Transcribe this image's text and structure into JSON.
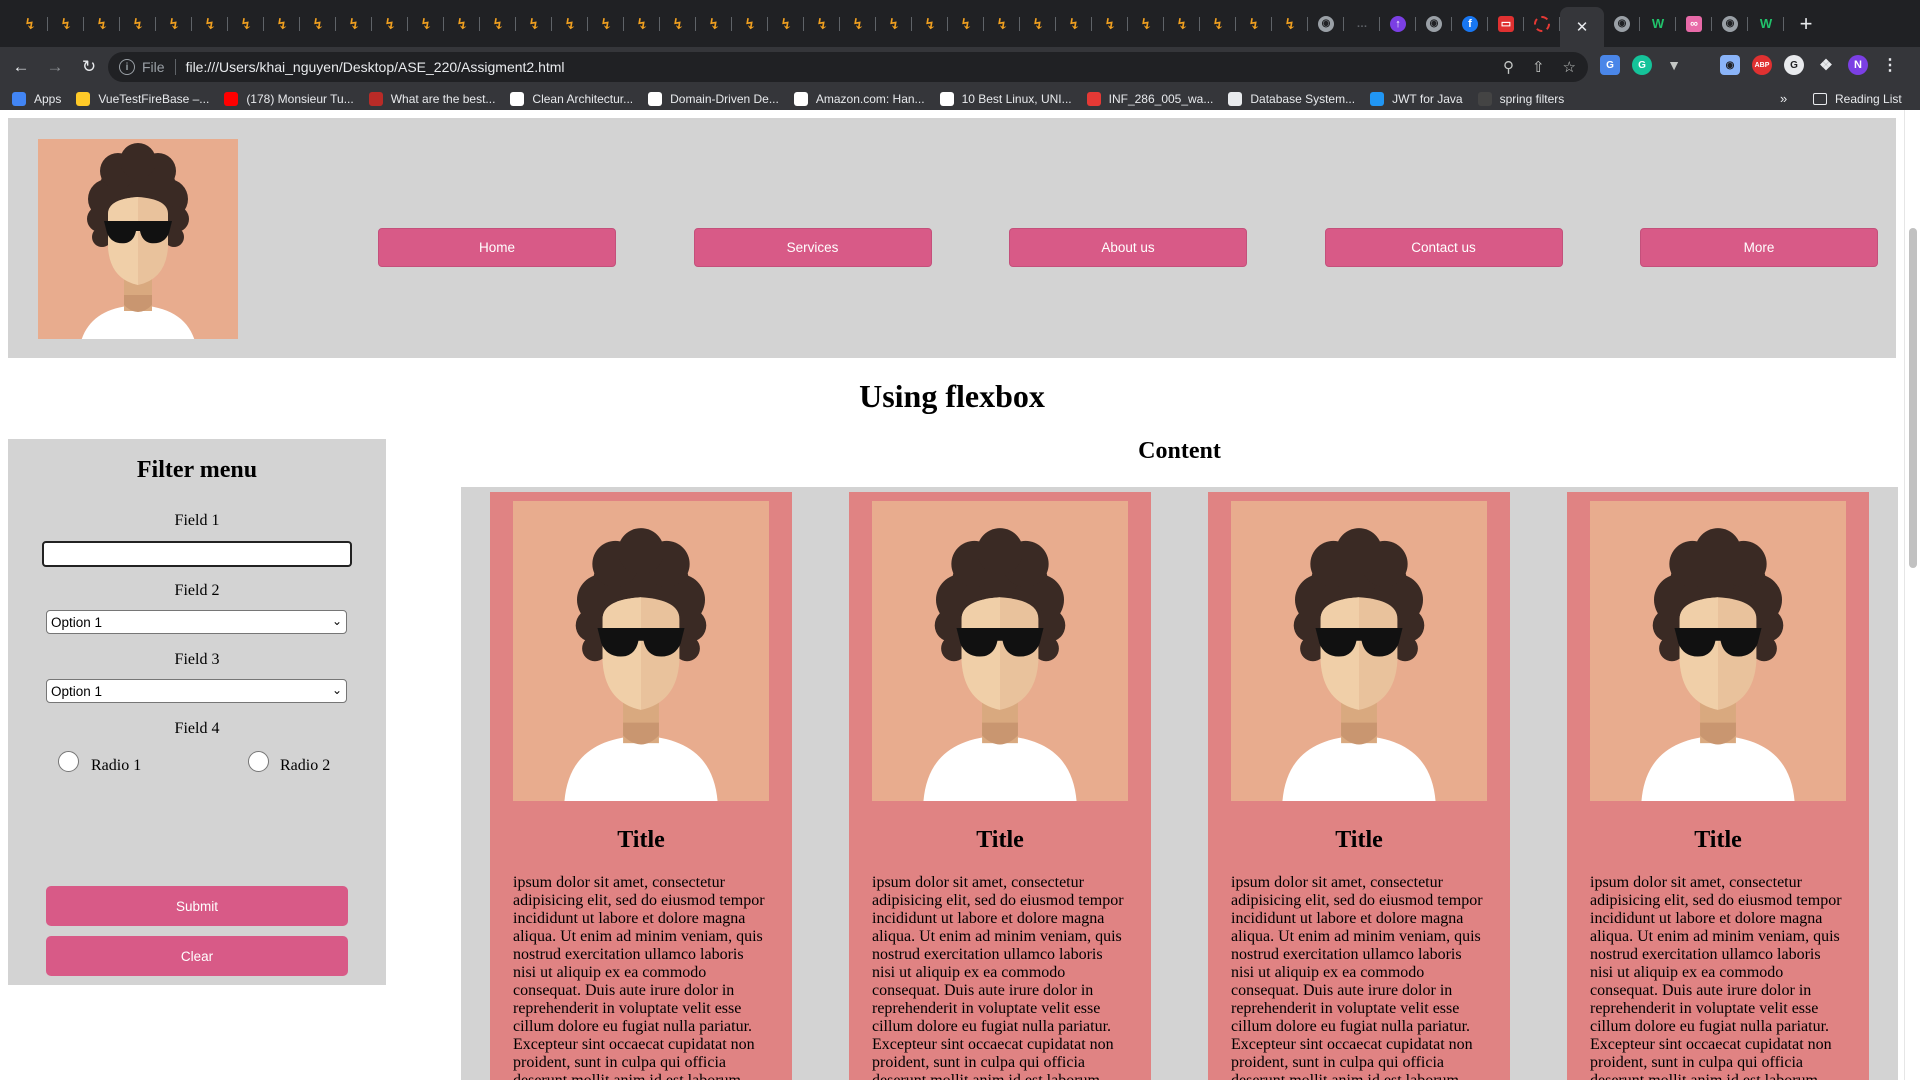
{
  "browser": {
    "tabs": [
      {
        "icon": "tweet-tab-icon"
      },
      {
        "icon": "tweet-tab-icon"
      },
      {
        "icon": "tweet-tab-icon"
      },
      {
        "icon": "tweet-tab-icon"
      },
      {
        "icon": "tweet-tab-icon"
      },
      {
        "icon": "tweet-tab-icon"
      },
      {
        "icon": "tweet-tab-icon"
      },
      {
        "icon": "tweet-tab-icon"
      },
      {
        "icon": "tweet-tab-icon"
      },
      {
        "icon": "tweet-tab-icon"
      },
      {
        "icon": "tweet-tab-icon"
      },
      {
        "icon": "tweet-tab-icon"
      },
      {
        "icon": "tweet-tab-icon"
      },
      {
        "icon": "tweet-tab-icon"
      },
      {
        "icon": "tweet-tab-icon"
      },
      {
        "icon": "tweet-tab-icon"
      },
      {
        "icon": "tweet-tab-icon"
      },
      {
        "icon": "tweet-tab-icon"
      },
      {
        "icon": "tweet-tab-icon"
      },
      {
        "icon": "tweet-tab-icon"
      },
      {
        "icon": "tweet-tab-icon"
      },
      {
        "icon": "tweet-tab-icon"
      },
      {
        "icon": "tweet-tab-icon"
      },
      {
        "icon": "tweet-tab-icon"
      },
      {
        "icon": "tweet-tab-icon"
      },
      {
        "icon": "tweet-tab-icon"
      },
      {
        "icon": "tweet-tab-icon"
      },
      {
        "icon": "tweet-tab-icon"
      },
      {
        "icon": "tweet-tab-icon"
      },
      {
        "icon": "tweet-tab-icon"
      },
      {
        "icon": "tweet-tab-icon"
      },
      {
        "icon": "tweet-tab-icon"
      },
      {
        "icon": "tweet-tab-icon"
      },
      {
        "icon": "tweet-tab-icon"
      },
      {
        "icon": "tweet-tab-icon"
      },
      {
        "icon": "tweet-tab-icon"
      },
      {
        "icon": "globe-icon"
      },
      {
        "icon": "blank-page-icon"
      },
      {
        "icon": "purple-extension-icon"
      },
      {
        "icon": "globe-icon"
      },
      {
        "icon": "facebook-icon"
      },
      {
        "icon": "red-app-icon"
      },
      {
        "icon": "loading-spinner-icon"
      },
      {
        "icon": "close-icon",
        "active": true
      },
      {
        "icon": "globe-icon"
      },
      {
        "icon": "w-icon"
      },
      {
        "icon": "pink-app-icon"
      },
      {
        "icon": "globe-icon"
      },
      {
        "icon": "w-icon"
      }
    ],
    "omnibox": {
      "scheme_label": "File",
      "url": "file:///Users/khai_nguyen/Desktop/ASE_220/Assigment2.html"
    },
    "profile_initial": "N",
    "bookmarks": [
      {
        "label": "Apps",
        "icon": "apps-grid-icon",
        "color": "#4285f4"
      },
      {
        "label": "VueTestFireBase –...",
        "icon": "firebase-icon",
        "color": "#ffca28"
      },
      {
        "label": "(178) Monsieur Tu...",
        "icon": "youtube-icon",
        "color": "#ff0000"
      },
      {
        "label": "What are the best...",
        "icon": "quora-icon",
        "color": "#b92b27"
      },
      {
        "label": "Clean Architectur...",
        "icon": "amazon-icon",
        "color": "#ffffff"
      },
      {
        "label": "Domain-Driven De...",
        "icon": "amazon-icon",
        "color": "#ffffff"
      },
      {
        "label": "Amazon.com: Han...",
        "icon": "amazon-icon",
        "color": "#ffffff"
      },
      {
        "label": "10 Best Linux, UNI...",
        "icon": "medium-icon",
        "color": "#ffffff"
      },
      {
        "label": "INF_286_005_wa...",
        "icon": "spinner-icon",
        "color": "#e53935"
      },
      {
        "label": "Database System...",
        "icon": "globe-icon",
        "color": "#e8eaed"
      },
      {
        "label": "JWT for Java",
        "icon": "jwt-icon",
        "color": "#2196f3"
      },
      {
        "label": "spring filters",
        "icon": "spring-icon",
        "color": "#444444"
      }
    ],
    "bookmarks_more": "»",
    "reading_list": "Reading List"
  },
  "page": {
    "heading": "Using flexbox",
    "nav": [
      "Home",
      "Services",
      "About us",
      "Contact us",
      "More"
    ],
    "filter": {
      "title": "Filter menu",
      "field1_label": "Field 1",
      "field1_value": "",
      "field2_label": "Field 2",
      "field2_selected": "Option 1",
      "field3_label": "Field 3",
      "field3_selected": "Option 1",
      "field4_label": "Field 4",
      "radio1_label": "Radio 1",
      "radio2_label": "Radio 2",
      "submit_label": "Submit",
      "clear_label": "Clear"
    },
    "content_title": "Content",
    "cards": [
      {
        "title": "Title",
        "text": "ipsum dolor sit amet, consectetur adipisicing elit, sed do eiusmod tempor incididunt ut labore et dolore magna aliqua. Ut enim ad minim veniam, quis nostrud exercitation ullamco laboris nisi ut aliquip ex ea commodo consequat. Duis aute irure dolor in reprehenderit in voluptate velit esse cillum dolore eu fugiat nulla pariatur. Excepteur sint occaecat cupidatat non proident, sunt in culpa qui officia deserunt mollit anim id est laborum."
      },
      {
        "title": "Title",
        "text": "ipsum dolor sit amet, consectetur adipisicing elit, sed do eiusmod tempor incididunt ut labore et dolore magna aliqua. Ut enim ad minim veniam, quis nostrud exercitation ullamco laboris nisi ut aliquip ex ea commodo consequat. Duis aute irure dolor in reprehenderit in voluptate velit esse cillum dolore eu fugiat nulla pariatur. Excepteur sint occaecat cupidatat non proident, sunt in culpa qui officia deserunt mollit anim id est laborum."
      },
      {
        "title": "Title",
        "text": "ipsum dolor sit amet, consectetur adipisicing elit, sed do eiusmod tempor incididunt ut labore et dolore magna aliqua. Ut enim ad minim veniam, quis nostrud exercitation ullamco laboris nisi ut aliquip ex ea commodo consequat. Duis aute irure dolor in reprehenderit in voluptate velit esse cillum dolore eu fugiat nulla pariatur. Excepteur sint occaecat cupidatat non proident, sunt in culpa qui officia deserunt mollit anim id est laborum."
      },
      {
        "title": "Title",
        "text": "ipsum dolor sit amet, consectetur adipisicing elit, sed do eiusmod tempor incididunt ut labore et dolore magna aliqua. Ut enim ad minim veniam, quis nostrud exercitation ullamco laboris nisi ut aliquip ex ea commodo consequat. Duis aute irure dolor in reprehenderit in voluptate velit esse cillum dolore eu fugiat nulla pariatur. Excepteur sint occaecat cupidatat non proident, sunt in culpa qui officia deserunt mollit anim id est laborum."
      }
    ],
    "colors": {
      "header_bg": "#d3d3d3",
      "button_pink": "#d85a87",
      "card_bg": "#e08383",
      "avatar_bg": "#e8ac8e"
    }
  }
}
